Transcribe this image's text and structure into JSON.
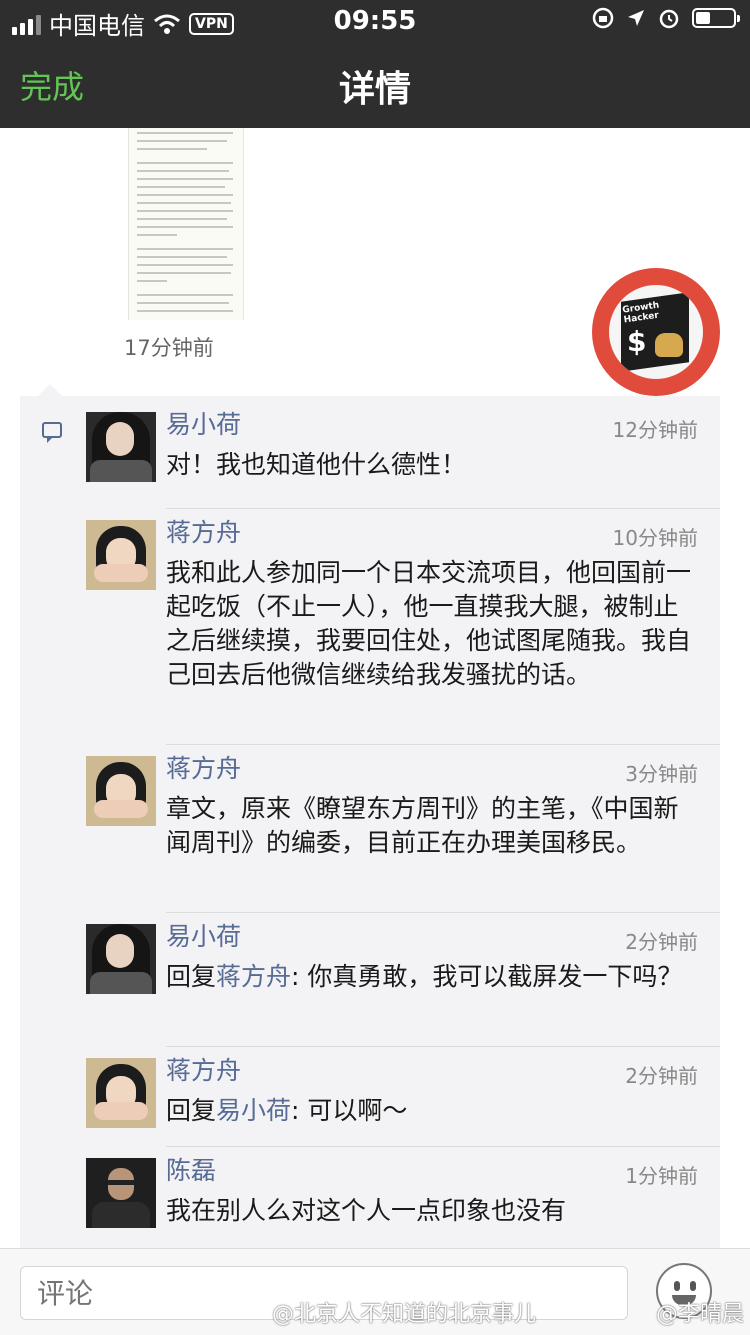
{
  "status_bar": {
    "carrier": "中国电信",
    "vpn": "VPN",
    "time": "09:55"
  },
  "nav": {
    "done_label": "完成",
    "title": "详情"
  },
  "post": {
    "time": "17分钟前"
  },
  "comments": [
    {
      "name": "易小荷",
      "time": "12分钟前",
      "text": "对！我也知道他什么德性！"
    },
    {
      "name": "蒋方舟",
      "time": "10分钟前",
      "text": "我和此人参加同一个日本交流项目，他回国前一起吃饭（不止一人），他一直摸我大腿，被制止之后继续摸，我要回住处，他试图尾随我。我自己回去后他微信继续给我发骚扰的话。"
    },
    {
      "name": "蒋方舟",
      "time": "3分钟前",
      "text": "章文，原来《瞭望东方周刊》的主笔，《中国新闻周刊》的编委，目前正在办理美国移民。"
    },
    {
      "name": "易小荷",
      "time": "2分钟前",
      "reply_prefix": "回复",
      "reply_to": "蒋方舟",
      "text": ": 你真勇敢，我可以截屏发一下吗？"
    },
    {
      "name": "蒋方舟",
      "time": "2分钟前",
      "reply_prefix": "回复",
      "reply_to": "易小荷",
      "text": ": 可以啊～"
    },
    {
      "name": "陈磊",
      "time": "1分钟前",
      "text": "我在别人么对这个人一点印象也没有"
    }
  ],
  "input": {
    "placeholder": "评论"
  },
  "watermarks": {
    "left": "@北京人不知道的北京事儿",
    "right": "@李晴晨"
  },
  "colors": {
    "nav_bg": "#2e2e2e",
    "accent_green": "#62c554",
    "name_blue": "#576b95"
  }
}
